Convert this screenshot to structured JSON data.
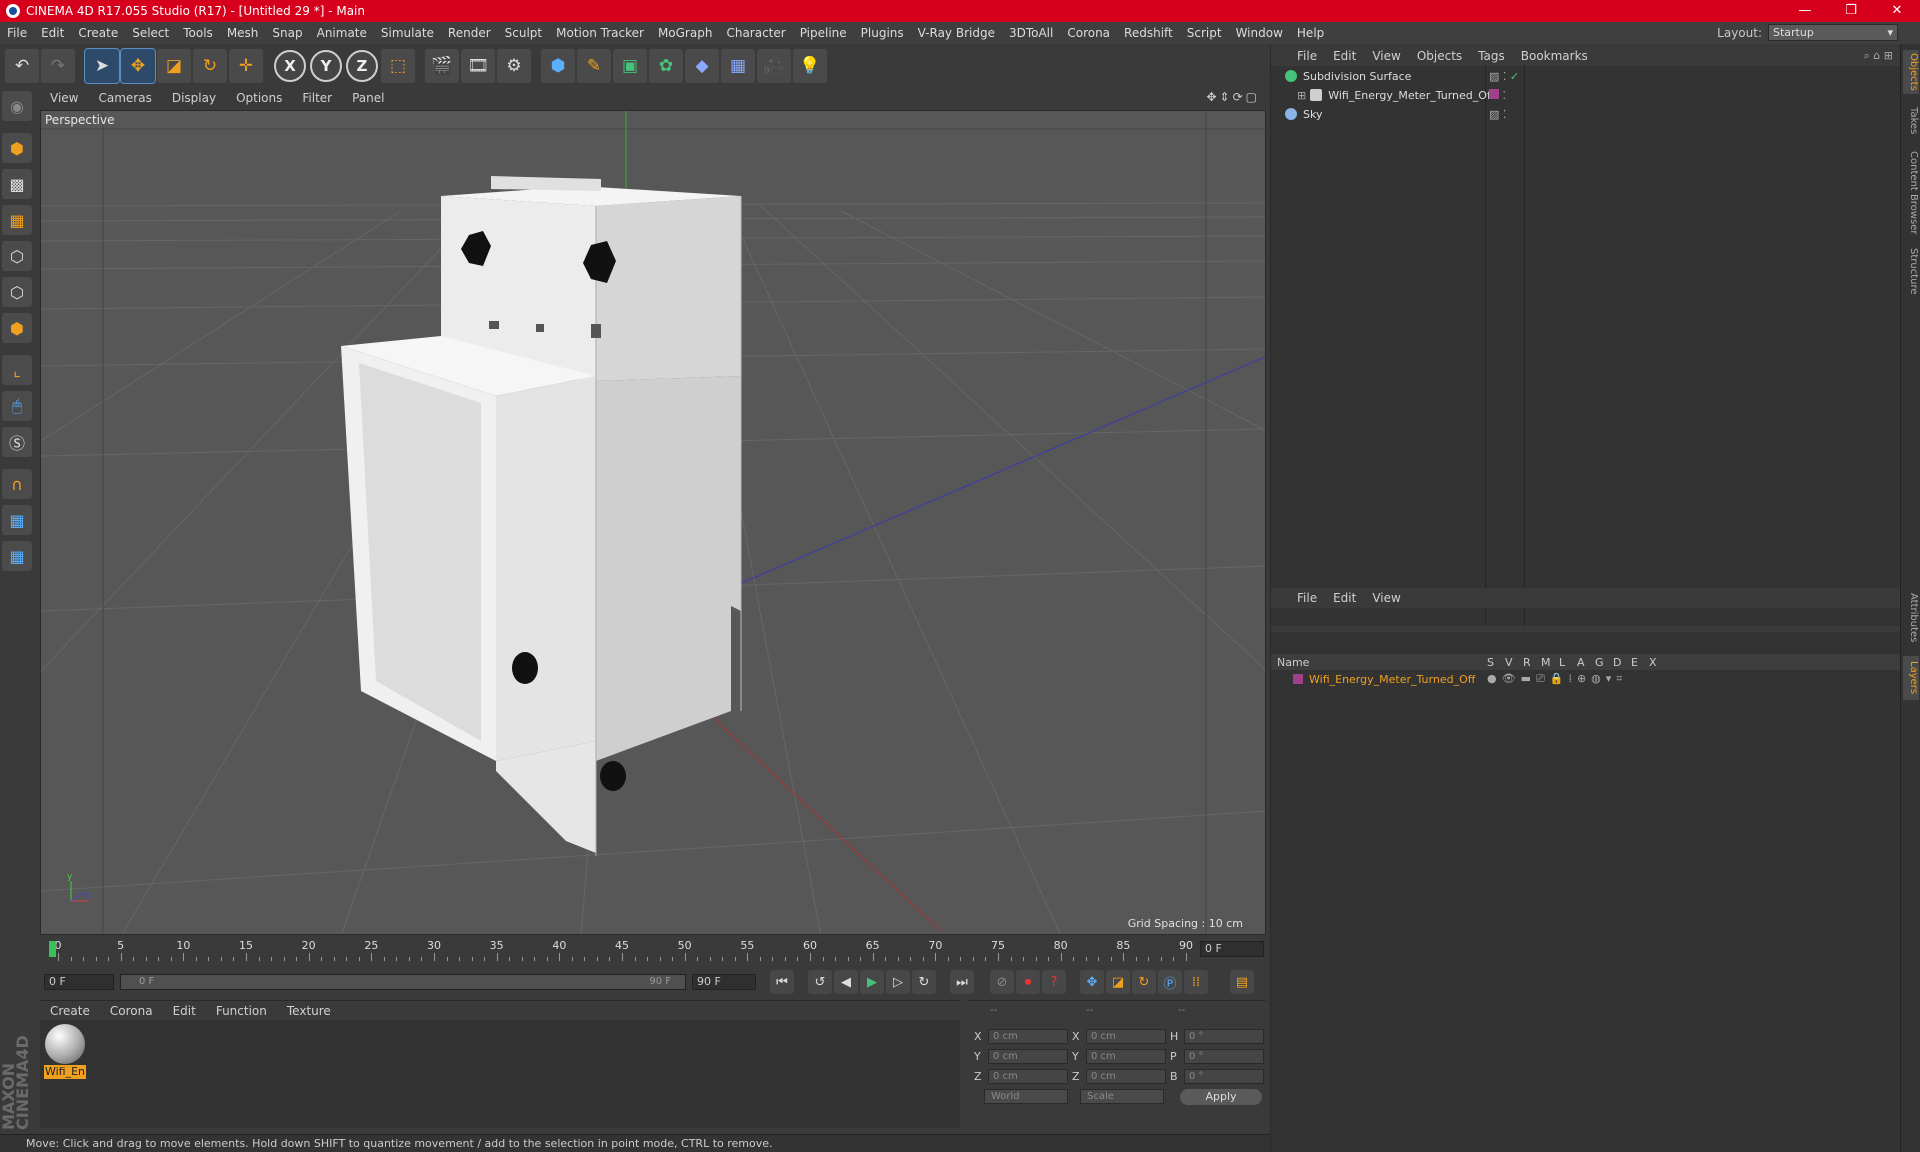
{
  "window": {
    "title": "CINEMA 4D R17.055 Studio (R17) - [Untitled 29 *] - Main",
    "controls": [
      "—",
      "❐",
      "✕"
    ]
  },
  "menubar": {
    "items": [
      "File",
      "Edit",
      "Create",
      "Select",
      "Tools",
      "Mesh",
      "Snap",
      "Animate",
      "Simulate",
      "Render",
      "Sculpt",
      "Motion Tracker",
      "MoGraph",
      "Character",
      "Pipeline",
      "Plugins",
      "V-Ray Bridge",
      "3DToAll",
      "Corona",
      "Redshift",
      "Script",
      "Window",
      "Help"
    ],
    "layout_label": "Layout:",
    "layout_value": "Startup"
  },
  "viewport": {
    "menu": [
      "View",
      "Cameras",
      "Display",
      "Options",
      "Filter",
      "Panel"
    ],
    "camera_label": "Perspective",
    "grid_spacing": "Grid Spacing : 10 cm",
    "colors": {
      "background": "#575757",
      "grid": "#6a6a6a",
      "object": "#e8e8e8"
    }
  },
  "timeline": {
    "ticks": [
      "0",
      "5",
      "10",
      "15",
      "20",
      "25",
      "30",
      "35",
      "40",
      "45",
      "50",
      "55",
      "60",
      "65",
      "70",
      "75",
      "80",
      "85",
      "90"
    ],
    "current_frame": "0 F"
  },
  "transport": {
    "start": "0 F",
    "slider_start": "0 F",
    "slider_end": "90 F",
    "end": "90 F"
  },
  "material_manager": {
    "menu": [
      "Create",
      "Corona",
      "Edit",
      "Function",
      "Texture"
    ],
    "materials": [
      {
        "name": "Wifi_En"
      }
    ]
  },
  "coordinates": {
    "header": [
      "--",
      "--",
      "--"
    ],
    "rows": [
      {
        "l1": "X",
        "v1": "0 cm",
        "l2": "X",
        "v2": "0 cm",
        "l3": "H",
        "v3": "0 °"
      },
      {
        "l1": "Y",
        "v1": "0 cm",
        "l2": "Y",
        "v2": "0 cm",
        "l3": "P",
        "v3": "0 °"
      },
      {
        "l1": "Z",
        "v1": "0 cm",
        "l2": "Z",
        "v2": "0 cm",
        "l3": "B",
        "v3": "0 °"
      }
    ],
    "space": "World",
    "mode": "Scale",
    "apply": "Apply"
  },
  "status": "Move: Click and drag to move elements. Hold down SHIFT to quantize movement / add to the selection in point mode, CTRL to remove.",
  "objects_panel": {
    "menu": [
      "File",
      "Edit",
      "View",
      "Objects",
      "Tags",
      "Bookmarks"
    ],
    "items": [
      {
        "name": "Subdivision Surface",
        "color": "#47c27a"
      },
      {
        "name": "Wifi_Energy_Meter_Turned_Off",
        "color": "#cfcfcf"
      },
      {
        "name": "Sky",
        "color": "#8ab4e6"
      }
    ]
  },
  "layers_panel": {
    "menu": [
      "File",
      "Edit",
      "View"
    ],
    "columns": [
      "Name",
      "S",
      "V",
      "R",
      "M",
      "L",
      "A",
      "G",
      "D",
      "E",
      "X"
    ],
    "layer_name": "Wifi_Energy_Meter_Turned_Off",
    "layer_color": "#f0a020"
  },
  "side_tabs": [
    "Objects",
    "Takes",
    "Content Browser",
    "Structure",
    "Attributes",
    "Layers"
  ]
}
